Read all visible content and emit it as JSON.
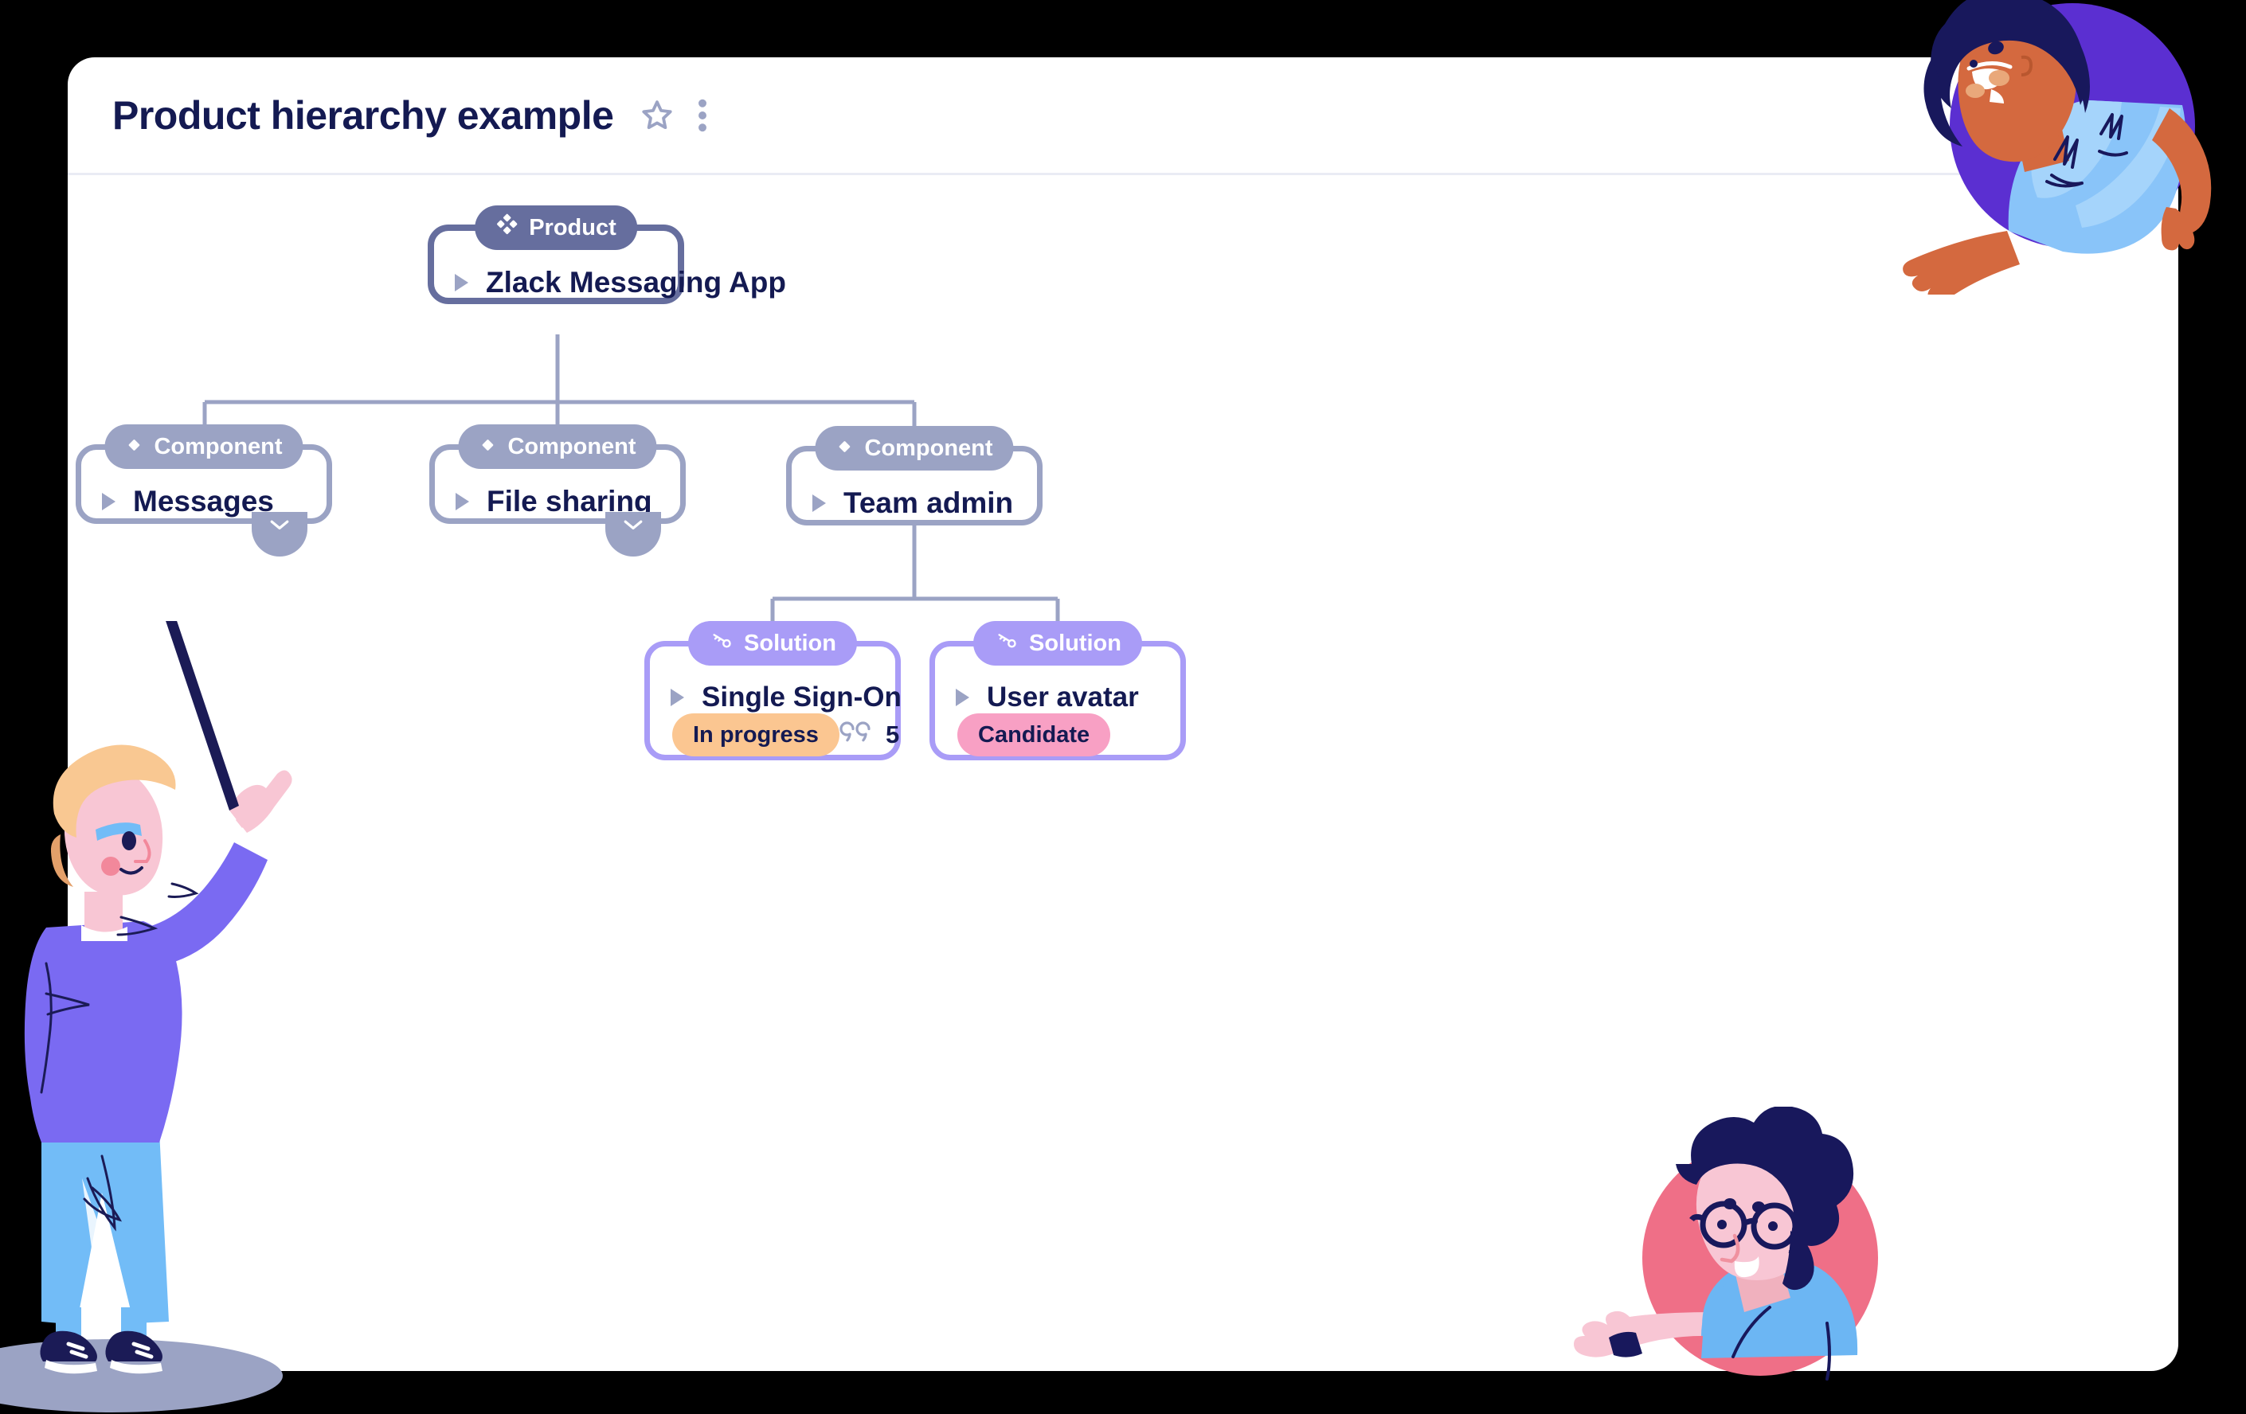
{
  "window": {
    "background_color": "#000000",
    "card_background": "#ffffff"
  },
  "header": {
    "title": "Product hierarchy example",
    "star_icon": "star-outline-icon",
    "menu_icon": "more-vertical-icon"
  },
  "palette": {
    "product_accent": "#666e9e",
    "component_accent": "#9ba3c4",
    "solution_accent": "#a99cf7",
    "text_dark": "#141a52",
    "badge_in_progress_bg": "#fbc691",
    "badge_candidate_bg": "#f8a0c4",
    "connector": "#9ba3c4"
  },
  "chart_data": {
    "type": "diagram",
    "title": "Product hierarchy example",
    "layout": "top-down tree",
    "levels": [
      "Product",
      "Component",
      "Solution"
    ],
    "nodes": [
      {
        "id": "product-zlack",
        "level": "Product",
        "pill_label": "Product",
        "pill_icon": "diamond-cluster-icon",
        "title": "Zlack Messaging App",
        "accent": "#666e9e",
        "expanded": true,
        "has_expand_handle": false,
        "status": null,
        "comments": null
      },
      {
        "id": "component-messages",
        "level": "Component",
        "pill_label": "Component",
        "pill_icon": "diamond-icon",
        "title": "Messages",
        "accent": "#9ba3c4",
        "expanded": false,
        "has_expand_handle": true,
        "status": null,
        "comments": null
      },
      {
        "id": "component-file-sharing",
        "level": "Component",
        "pill_label": "Component",
        "pill_icon": "diamond-icon",
        "title": "File sharing",
        "accent": "#9ba3c4",
        "expanded": false,
        "has_expand_handle": true,
        "status": null,
        "comments": null
      },
      {
        "id": "component-team-admin",
        "level": "Component",
        "pill_label": "Component",
        "pill_icon": "diamond-icon",
        "title": "Team admin",
        "accent": "#9ba3c4",
        "expanded": true,
        "has_expand_handle": false,
        "status": null,
        "comments": null
      },
      {
        "id": "solution-sso",
        "level": "Solution",
        "pill_label": "Solution",
        "pill_icon": "key-icon",
        "title": "Single Sign-On",
        "accent": "#a99cf7",
        "expanded": false,
        "has_expand_handle": false,
        "status": "In progress",
        "status_color": "#fbc691",
        "comments": "5",
        "comment_icon": "quote-icon"
      },
      {
        "id": "solution-user-avatar",
        "level": "Solution",
        "pill_label": "Solution",
        "pill_icon": "key-icon",
        "title": "User avatar",
        "accent": "#a99cf7",
        "expanded": false,
        "has_expand_handle": false,
        "status": "Candidate",
        "status_color": "#f8a0c4",
        "comments": null
      }
    ],
    "edges": [
      {
        "from": "product-zlack",
        "to": "component-messages"
      },
      {
        "from": "product-zlack",
        "to": "component-file-sharing"
      },
      {
        "from": "product-zlack",
        "to": "component-team-admin"
      },
      {
        "from": "component-team-admin",
        "to": "solution-sso"
      },
      {
        "from": "component-team-admin",
        "to": "solution-user-avatar"
      }
    ]
  },
  "nodes": {
    "product": {
      "pill_label": "Product",
      "title": "Zlack Messaging App"
    },
    "messages": {
      "pill_label": "Component",
      "title": "Messages"
    },
    "file_sharing": {
      "pill_label": "Component",
      "title": "File sharing"
    },
    "team_admin": {
      "pill_label": "Component",
      "title": "Team admin"
    },
    "sso": {
      "pill_label": "Solution",
      "title": "Single Sign-On",
      "status": "In progress",
      "comment_count": "5"
    },
    "user_avatar": {
      "pill_label": "Solution",
      "title": "User avatar",
      "status": "Candidate"
    }
  },
  "illustrations": [
    {
      "name": "presenter-with-pointer",
      "position": "bottom-left"
    },
    {
      "name": "woman-waving-purple-circle",
      "position": "top-right"
    },
    {
      "name": "man-waving-pink-circle",
      "position": "bottom-right"
    }
  ]
}
